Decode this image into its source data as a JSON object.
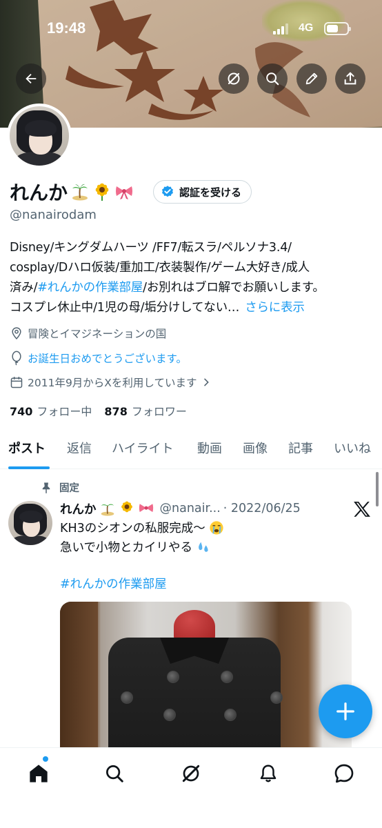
{
  "status_bar": {
    "time": "19:48",
    "network": "4G"
  },
  "header": {
    "back_icon": "arrow-left-icon",
    "grok_icon": "grok-icon",
    "search_icon": "search-icon",
    "edit_icon": "pencil-icon",
    "share_icon": "share-icon"
  },
  "profile": {
    "name": "れんか",
    "emojis": [
      "island-emoji",
      "sunflower-emoji",
      "ribbon-emoji"
    ],
    "verify_label": "認証を受ける",
    "handle": "@nanairodam",
    "bio": {
      "line1": "Disney/キングダムハーツ /FF7/転スラ/ペルソナ3.4/",
      "line2": "cosplay/Dハロ仮装/重加工/衣装製作/ゲーム大好き/成人",
      "line3_pre": "済み/",
      "line3_hash": "#れんかの作業部屋",
      "line3_post": "/お別れはブロ解でお願いします。",
      "line4": "コスプレ休止中/1児の母/垢分けしてない…",
      "more": "さらに表示"
    },
    "location": "冒険とイマジネーションの国",
    "birthday": "お誕生日おめでとうございます。",
    "joined": "2011年9月からXを利用しています",
    "following_count": "740",
    "following_label": "フォロー中",
    "followers_count": "878",
    "followers_label": "フォロワー"
  },
  "tabs": [
    "ポスト",
    "返信",
    "ハイライト",
    "動画",
    "画像",
    "記事",
    "いいね"
  ],
  "active_tab": "ポスト",
  "post": {
    "pinned_label": "固定",
    "name": "れんか",
    "handle": "@nanair...",
    "date": "· 2022/06/25",
    "line1": "KH3のシオンの私服完成〜",
    "line2": "急いで小物とカイリやる",
    "hashtag": "#れんかの作業部屋"
  },
  "colors": {
    "accent": "#1d9bf0",
    "text": "#0f1419",
    "secondary": "#536471"
  },
  "bottom_nav": [
    "home-icon",
    "search-icon",
    "grok-icon",
    "bell-icon",
    "messages-icon"
  ]
}
